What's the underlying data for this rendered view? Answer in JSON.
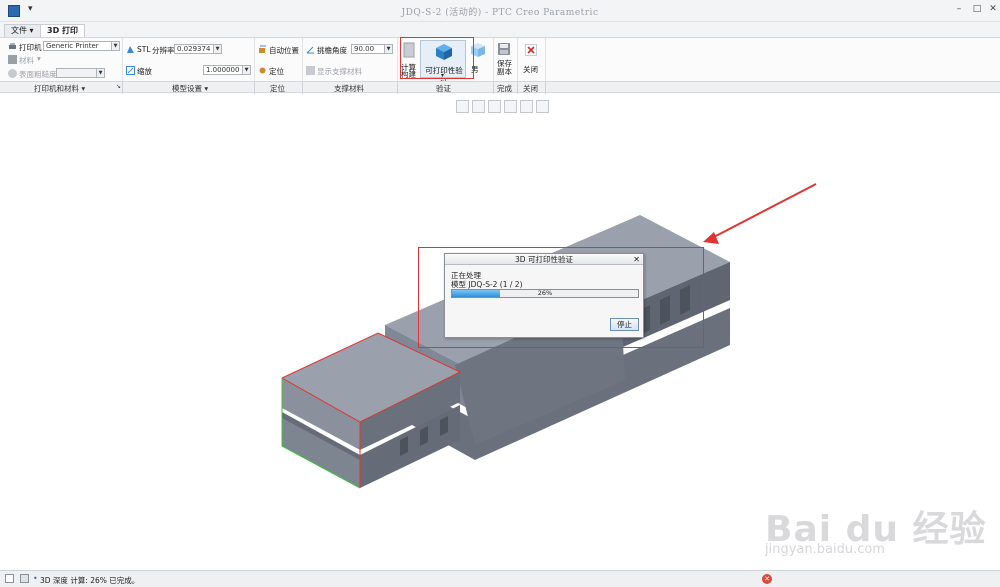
{
  "window": {
    "title": "JDQ-S-2 (活动的) - PTC Creo Parametric"
  },
  "tabs": [
    {
      "label": "文件"
    },
    {
      "label": "3D 打印"
    }
  ],
  "ribbon": {
    "printers_materials": {
      "printer_label": "打印机",
      "printer_value": "Generic Printer",
      "material_label": "材料",
      "roughness_label": "表面粗糙度",
      "group_label": "打印机和材料"
    },
    "model_settings": {
      "stl_label": "STL",
      "resolution_label": "分辨率",
      "resolution_value": "0.029374",
      "scale_label": "缩放",
      "scale_value": "1.000000",
      "group_label": "模型设置"
    },
    "positioning": {
      "auto_label": "自动位置",
      "position_label": "定位",
      "group_label": "定位"
    },
    "support": {
      "angle_label": "挑檐角度",
      "angle_value": "90.00",
      "show_support_label": "显示支撑材料",
      "group_label": "支撑材料"
    },
    "verify": {
      "compute_label": "计算",
      "compute_sub": "构建",
      "printability_label": "可打印性验证",
      "preview_label": "男",
      "group_label": "验证"
    },
    "finish": {
      "save_copy_label": "保存",
      "save_copy_sub": "副本",
      "group_label": "完成"
    },
    "close": {
      "close_label": "关闭",
      "group_label": "关闭"
    }
  },
  "dialog": {
    "title": "3D 可打印性验证",
    "line1": "正在处理",
    "line2": "模型 JDQ-S-2 (1 / 2)",
    "progress_text": "26%",
    "progress": 0.26,
    "stop_label": "停止"
  },
  "status": {
    "message": "3D 深度 计算: 26% 已完成。"
  },
  "watermark": {
    "brand": "Bai du 经验",
    "url": "jingyan.baidu.com"
  },
  "colors": {
    "accent": "#2d6bb0",
    "highlight": "#e03434",
    "model": "#8e96a3"
  }
}
